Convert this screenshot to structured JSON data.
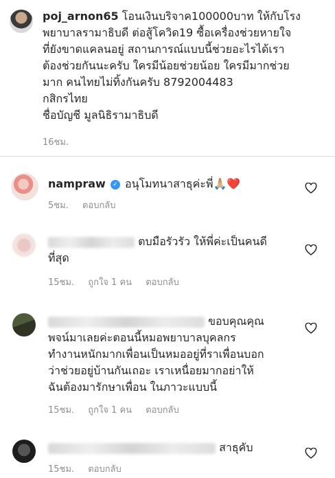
{
  "caption": {
    "username": "poj_arnon65",
    "lines": [
      "โอนเงินบริจาค100000บาท ให้กับโรง",
      "พยาบาลรามาธิบดี ต่อสู้โควิด19  ซื้อเครื่องช่วยหายใจ",
      "ที่ยังขาดแคลนอยู่ สถานการณ์แบบนี้ช่วยอะไรได้เรา",
      "ต้องช่วยกันนะครับ ใครมีน้อยช่วยน้อย ใครมีมากช่วย",
      "มาก คนไทยไม่ทิ้งกันครับ 8792004483",
      "กสิกรไทย",
      "ชื่อบัญชี มูลนิธิรามาธิบดี"
    ],
    "time": "16ชม."
  },
  "comments": [
    {
      "username": "nampraw",
      "verified": true,
      "text": "อนุโมทนาสาธุค่ะพี่🙏🏼❤️",
      "time": "5ชม.",
      "reply": "ตอบกลับ"
    },
    {
      "text_line1": "ตบมือรัวรัว ให้พี่ค่ะเป็นคนดี",
      "text_line2": "ที่สุด",
      "time": "15ชม.",
      "likes": "ถูกใจ 1 คน",
      "reply": "ตอบกลับ"
    },
    {
      "text_line1": "ขอบคุณคุณ",
      "lines": [
        "พจน์มาเลยค่ะตอนนี้หมอพยาบาลบุคลกร",
        "ทำงานหนักมากเพื่อนเป็นหมออยู่ที่ราเพื่อนบอก",
        "ว่าช่วยอยู่บ้านกันเถอะ เราเหนื่อยมากอย่าให้",
        "ฉันต้องมารักษาเพื่อน ในภาวะแบบนี้"
      ],
      "time": "15ชม.",
      "likes": "ถูกใจ 1 คน",
      "reply": "ตอบกลับ"
    },
    {
      "text": "สาธุคับ",
      "time": "15ชม.",
      "reply": "ตอบกลับ"
    }
  ],
  "icons": {
    "like": "heart-outline-icon",
    "verified": "verified-badge-icon"
  },
  "colors": {
    "text": "#262626",
    "meta": "#8e8e8e",
    "verified": "#3897f0",
    "divider": "#dbdbdb"
  }
}
